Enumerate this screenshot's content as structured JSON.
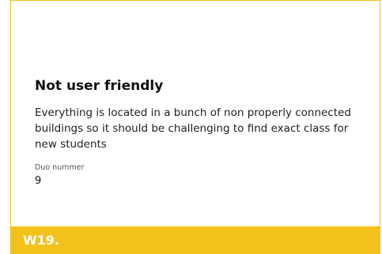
{
  "card": {
    "title": "Not user friendly",
    "description": "Everything is located in a bunch of non properly connected buildings so it should be challenging to find exact class for new students",
    "field_label": "Duo nummer",
    "field_value": "9"
  },
  "footer": {
    "label": "W19."
  },
  "colors": {
    "accent": "#f2c11c",
    "border": "#f0c21a"
  }
}
